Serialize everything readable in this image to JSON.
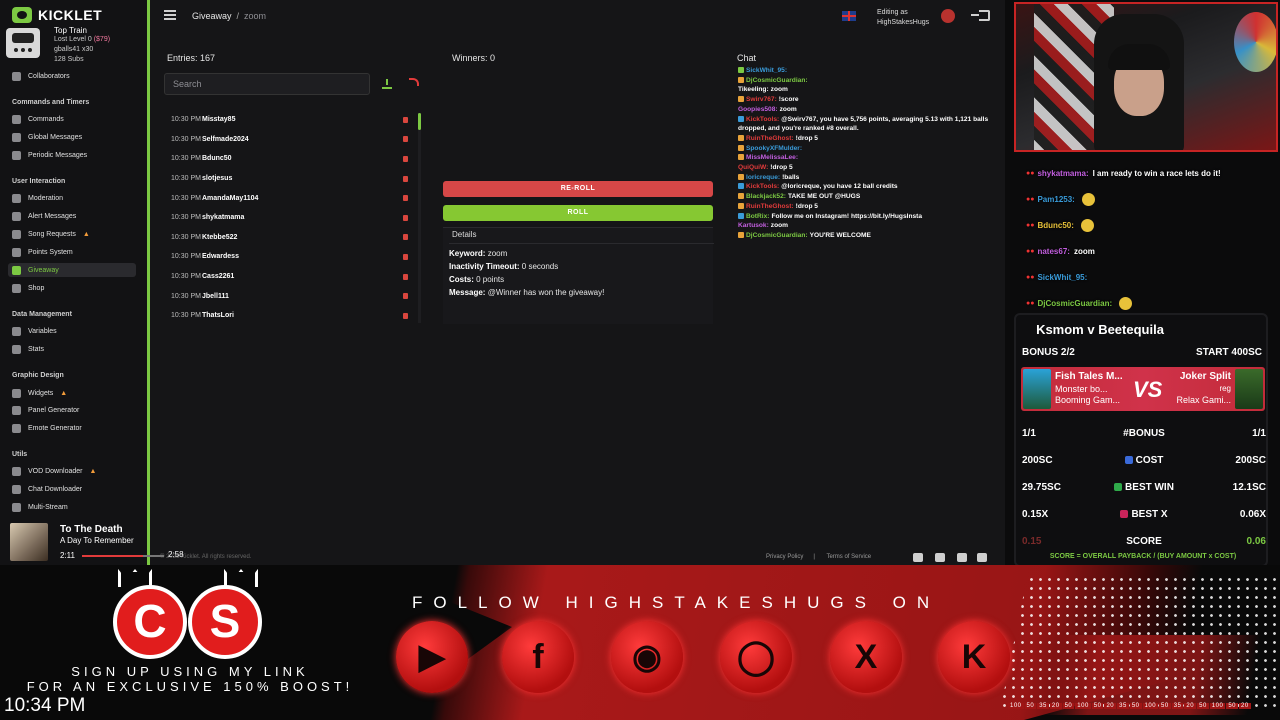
{
  "app": {
    "brand": "KICKLET",
    "train": {
      "title": "Top Train",
      "line1": "Lost Level 0",
      "line1_amt": "($79)",
      "line2": "gballs41 x30",
      "line3": "128 Subs"
    },
    "nav": {
      "collaborators": "Collaborators",
      "sections": {
        "commands": "Commands and Timers",
        "interaction": "User Interaction",
        "data": "Data Management",
        "graphic": "Graphic Design",
        "utils": "Utils"
      },
      "items": {
        "commands": "Commands",
        "global_messages": "Global Messages",
        "periodic_messages": "Periodic Messages",
        "moderation": "Moderation",
        "alert_messages": "Alert Messages",
        "song_requests": "Song Requests",
        "points_system": "Points System",
        "giveaway": "Giveaway",
        "shop": "Shop",
        "variables": "Variables",
        "stats": "Stats",
        "widgets": "Widgets",
        "panel_generator": "Panel Generator",
        "emote_generator": "Emote Generator",
        "vod_downloader": "VOD Downloader",
        "chat_downloader": "Chat Downloader",
        "multi_stream": "Multi-Stream"
      }
    },
    "music": {
      "song": "To The Death",
      "artist": "A Day To Remember",
      "current": "2:11",
      "duration": "2:58",
      "progress": 0.74
    },
    "topbar": {
      "crumb_root": "Giveaway",
      "crumb_sep": "/",
      "crumb_current": "zoom",
      "editing_label": "Editing as",
      "editing_user": "HighStakesHugs"
    },
    "entries": {
      "label": "Entries: 167",
      "search_placeholder": "Search",
      "list": [
        {
          "time": "10:30 PM",
          "user": "Misstay85"
        },
        {
          "time": "10:30 PM",
          "user": "Selfmade2024"
        },
        {
          "time": "10:30 PM",
          "user": "Bdunc50"
        },
        {
          "time": "10:30 PM",
          "user": "slotjesus"
        },
        {
          "time": "10:30 PM",
          "user": "AmandaMay1104"
        },
        {
          "time": "10:30 PM",
          "user": "shykatmama"
        },
        {
          "time": "10:30 PM",
          "user": "Ktebbe522"
        },
        {
          "time": "10:30 PM",
          "user": "Edwardess"
        },
        {
          "time": "10:30 PM",
          "user": "Cass2261"
        },
        {
          "time": "10:30 PM",
          "user": "Jbell111"
        },
        {
          "time": "10:30 PM",
          "user": "ThatsLori"
        }
      ]
    },
    "winners": {
      "label": "Winners: 0"
    },
    "buttons": {
      "reroll": "RE-ROLL",
      "roll": "ROLL"
    },
    "details": {
      "title": "Details",
      "keyword_label": "Keyword:",
      "keyword": "zoom",
      "timeout_label": "Inactivity Timeout:",
      "timeout": "0 seconds",
      "costs_label": "Costs:",
      "costs": "0 points",
      "message_label": "Message:",
      "message": "@Winner has won the giveaway!"
    },
    "chat": {
      "title": "Chat",
      "messages": [
        {
          "name": "SickWhit_95:",
          "color": "#3a9bd9",
          "text": "",
          "badge": "#7cc943"
        },
        {
          "name": "DjCosmicGuardian:",
          "color": "#7cc943",
          "text": "",
          "badge": "#e8a33a"
        },
        {
          "name": "Tikeeling:",
          "color": "#ffffff",
          "text": "zoom",
          "badge": ""
        },
        {
          "name": "Swirv767:",
          "color": "#e23b3b",
          "text": "!score",
          "badge": "#e8a33a"
        },
        {
          "name": "Goopies508:",
          "color": "#c35fe0",
          "text": "zoom",
          "badge": ""
        },
        {
          "name": "KickTools:",
          "color": "#e23b3b",
          "text": "@Swirv767, you have 5,756 points, averaging 5.13 with 1,121 balls dropped, and you're ranked #8 overall.",
          "badge": "#3a9bd9"
        },
        {
          "name": "RuinTheGhost:",
          "color": "#e23b3b",
          "text": "!drop 5",
          "badge": "#e8a33a"
        },
        {
          "name": "SpookyXFMulder:",
          "color": "#3a9bd9",
          "text": "",
          "badge": "#e8a33a"
        },
        {
          "name": "MissMelissaLee:",
          "color": "#c35fe0",
          "text": "",
          "badge": "#e8a33a"
        },
        {
          "name": "QuiQuiW:",
          "color": "#e23b3b",
          "text": "!drop 5",
          "badge": ""
        },
        {
          "name": "loricreque:",
          "color": "#3a9bd9",
          "text": "!balls",
          "badge": "#e8a33a"
        },
        {
          "name": "KickTools:",
          "color": "#e23b3b",
          "text": "@loricreque, you have 12 ball credits",
          "badge": "#3a9bd9"
        },
        {
          "name": "Blackjack52:",
          "color": "#7cc943",
          "text": "TAKE ME OUT @HUGS",
          "badge": "#e8a33a"
        },
        {
          "name": "RuinTheGhost:",
          "color": "#e23b3b",
          "text": "!drop 5",
          "badge": "#e8a33a"
        },
        {
          "name": "BotRix:",
          "color": "#7cc943",
          "text": "Follow me on Instagram! https://bit.ly/HugsInsta",
          "badge": "#3a9bd9"
        },
        {
          "name": "Kartusok:",
          "color": "#c35fe0",
          "text": "zoom",
          "badge": ""
        },
        {
          "name": "DjCosmicGuardian:",
          "color": "#7cc943",
          "text": "YOU'RE WELCOME",
          "badge": "#e8a33a"
        }
      ]
    },
    "footer": {
      "copyright": "© 2025 Kicklet. All rights reserved.",
      "privacy": "Privacy Policy",
      "terms": "Terms of Service"
    }
  },
  "stream_chat": [
    {
      "name": "shykatmama:",
      "color": "#c35fe0",
      "text": "I am ready to win a race lets do it!",
      "emoji": false
    },
    {
      "name": "Pam1253:",
      "color": "#3a9bd9",
      "text": "",
      "emoji": true
    },
    {
      "name": "Bdunc50:",
      "color": "#e8c23a",
      "text": "",
      "emoji": true
    },
    {
      "name": "nates67:",
      "color": "#c35fe0",
      "text": "zoom",
      "emoji": false
    },
    {
      "name": "SickWhit_95:",
      "color": "#3a9bd9",
      "text": "",
      "emoji": false
    },
    {
      "name": "DjCosmicGuardian:",
      "color": "#7cc943",
      "text": "",
      "emoji": true
    }
  ],
  "bonus": {
    "title": "Ksmom v Beetequila",
    "bonus_label": "BONUS 2/2",
    "start": "START 400SC",
    "game1": {
      "name": "Fish Tales M...",
      "sub": "Monster bo...",
      "provider": "Booming Gam..."
    },
    "vs": "VS",
    "game2": {
      "name": "Joker Split",
      "sub": "reg",
      "provider": "Relax Gami..."
    },
    "rows": [
      {
        "left": "1/1",
        "mid": "BONUS",
        "right": "1/1",
        "icon": "#"
      },
      {
        "left": "200SC",
        "mid": "COST",
        "right": "200SC",
        "icon": "coin"
      },
      {
        "left": "29.75SC",
        "mid": "BEST WIN",
        "right": "12.1SC",
        "icon": "trophy"
      },
      {
        "left": "0.15X",
        "mid": "BEST X",
        "right": "0.06X",
        "icon": "x"
      },
      {
        "left": "0.15",
        "mid": "SCORE",
        "right": "0.06",
        "icon": ""
      }
    ],
    "formula": "SCORE = OVERALL PAYBACK / (BUY AMOUNT x COST)"
  },
  "overlay": {
    "logo_left": "C",
    "logo_right": "S",
    "signup_line1": "SIGN UP USING MY LINK",
    "signup_line2": "FOR AN EXCLUSIVE 150% BOOST!",
    "clock": "10:34 PM",
    "follow": "FOLLOW HIGHSTAKESHUGS ON",
    "socials": [
      "youtube-icon",
      "facebook-icon",
      "discord-icon",
      "instagram-icon",
      "x-icon",
      "kick-icon"
    ],
    "numbers": [
      "100",
      "50",
      "35",
      "20",
      "50",
      "100",
      "50",
      "20",
      "35",
      "50",
      "100"
    ]
  },
  "colors": {
    "accent": "#7cc943",
    "danger": "#d64747",
    "brand_red": "#e11d1d"
  }
}
